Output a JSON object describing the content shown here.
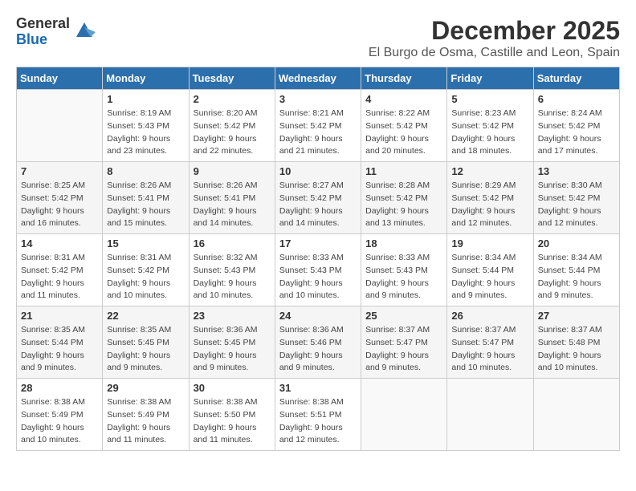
{
  "logo": {
    "general": "General",
    "blue": "Blue"
  },
  "title": "December 2025",
  "location": "El Burgo de Osma, Castille and Leon, Spain",
  "weekdays": [
    "Sunday",
    "Monday",
    "Tuesday",
    "Wednesday",
    "Thursday",
    "Friday",
    "Saturday"
  ],
  "weeks": [
    [
      {
        "day": "",
        "info": ""
      },
      {
        "day": "1",
        "info": "Sunrise: 8:19 AM\nSunset: 5:43 PM\nDaylight: 9 hours\nand 23 minutes."
      },
      {
        "day": "2",
        "info": "Sunrise: 8:20 AM\nSunset: 5:42 PM\nDaylight: 9 hours\nand 22 minutes."
      },
      {
        "day": "3",
        "info": "Sunrise: 8:21 AM\nSunset: 5:42 PM\nDaylight: 9 hours\nand 21 minutes."
      },
      {
        "day": "4",
        "info": "Sunrise: 8:22 AM\nSunset: 5:42 PM\nDaylight: 9 hours\nand 20 minutes."
      },
      {
        "day": "5",
        "info": "Sunrise: 8:23 AM\nSunset: 5:42 PM\nDaylight: 9 hours\nand 18 minutes."
      },
      {
        "day": "6",
        "info": "Sunrise: 8:24 AM\nSunset: 5:42 PM\nDaylight: 9 hours\nand 17 minutes."
      }
    ],
    [
      {
        "day": "7",
        "info": "Sunrise: 8:25 AM\nSunset: 5:42 PM\nDaylight: 9 hours\nand 16 minutes."
      },
      {
        "day": "8",
        "info": "Sunrise: 8:26 AM\nSunset: 5:41 PM\nDaylight: 9 hours\nand 15 minutes."
      },
      {
        "day": "9",
        "info": "Sunrise: 8:26 AM\nSunset: 5:41 PM\nDaylight: 9 hours\nand 14 minutes."
      },
      {
        "day": "10",
        "info": "Sunrise: 8:27 AM\nSunset: 5:42 PM\nDaylight: 9 hours\nand 14 minutes."
      },
      {
        "day": "11",
        "info": "Sunrise: 8:28 AM\nSunset: 5:42 PM\nDaylight: 9 hours\nand 13 minutes."
      },
      {
        "day": "12",
        "info": "Sunrise: 8:29 AM\nSunset: 5:42 PM\nDaylight: 9 hours\nand 12 minutes."
      },
      {
        "day": "13",
        "info": "Sunrise: 8:30 AM\nSunset: 5:42 PM\nDaylight: 9 hours\nand 12 minutes."
      }
    ],
    [
      {
        "day": "14",
        "info": "Sunrise: 8:31 AM\nSunset: 5:42 PM\nDaylight: 9 hours\nand 11 minutes."
      },
      {
        "day": "15",
        "info": "Sunrise: 8:31 AM\nSunset: 5:42 PM\nDaylight: 9 hours\nand 10 minutes."
      },
      {
        "day": "16",
        "info": "Sunrise: 8:32 AM\nSunset: 5:43 PM\nDaylight: 9 hours\nand 10 minutes."
      },
      {
        "day": "17",
        "info": "Sunrise: 8:33 AM\nSunset: 5:43 PM\nDaylight: 9 hours\nand 10 minutes."
      },
      {
        "day": "18",
        "info": "Sunrise: 8:33 AM\nSunset: 5:43 PM\nDaylight: 9 hours\nand 9 minutes."
      },
      {
        "day": "19",
        "info": "Sunrise: 8:34 AM\nSunset: 5:44 PM\nDaylight: 9 hours\nand 9 minutes."
      },
      {
        "day": "20",
        "info": "Sunrise: 8:34 AM\nSunset: 5:44 PM\nDaylight: 9 hours\nand 9 minutes."
      }
    ],
    [
      {
        "day": "21",
        "info": "Sunrise: 8:35 AM\nSunset: 5:44 PM\nDaylight: 9 hours\nand 9 minutes."
      },
      {
        "day": "22",
        "info": "Sunrise: 8:35 AM\nSunset: 5:45 PM\nDaylight: 9 hours\nand 9 minutes."
      },
      {
        "day": "23",
        "info": "Sunrise: 8:36 AM\nSunset: 5:45 PM\nDaylight: 9 hours\nand 9 minutes."
      },
      {
        "day": "24",
        "info": "Sunrise: 8:36 AM\nSunset: 5:46 PM\nDaylight: 9 hours\nand 9 minutes."
      },
      {
        "day": "25",
        "info": "Sunrise: 8:37 AM\nSunset: 5:47 PM\nDaylight: 9 hours\nand 9 minutes."
      },
      {
        "day": "26",
        "info": "Sunrise: 8:37 AM\nSunset: 5:47 PM\nDaylight: 9 hours\nand 10 minutes."
      },
      {
        "day": "27",
        "info": "Sunrise: 8:37 AM\nSunset: 5:48 PM\nDaylight: 9 hours\nand 10 minutes."
      }
    ],
    [
      {
        "day": "28",
        "info": "Sunrise: 8:38 AM\nSunset: 5:49 PM\nDaylight: 9 hours\nand 10 minutes."
      },
      {
        "day": "29",
        "info": "Sunrise: 8:38 AM\nSunset: 5:49 PM\nDaylight: 9 hours\nand 11 minutes."
      },
      {
        "day": "30",
        "info": "Sunrise: 8:38 AM\nSunset: 5:50 PM\nDaylight: 9 hours\nand 11 minutes."
      },
      {
        "day": "31",
        "info": "Sunrise: 8:38 AM\nSunset: 5:51 PM\nDaylight: 9 hours\nand 12 minutes."
      },
      {
        "day": "",
        "info": ""
      },
      {
        "day": "",
        "info": ""
      },
      {
        "day": "",
        "info": ""
      }
    ]
  ]
}
